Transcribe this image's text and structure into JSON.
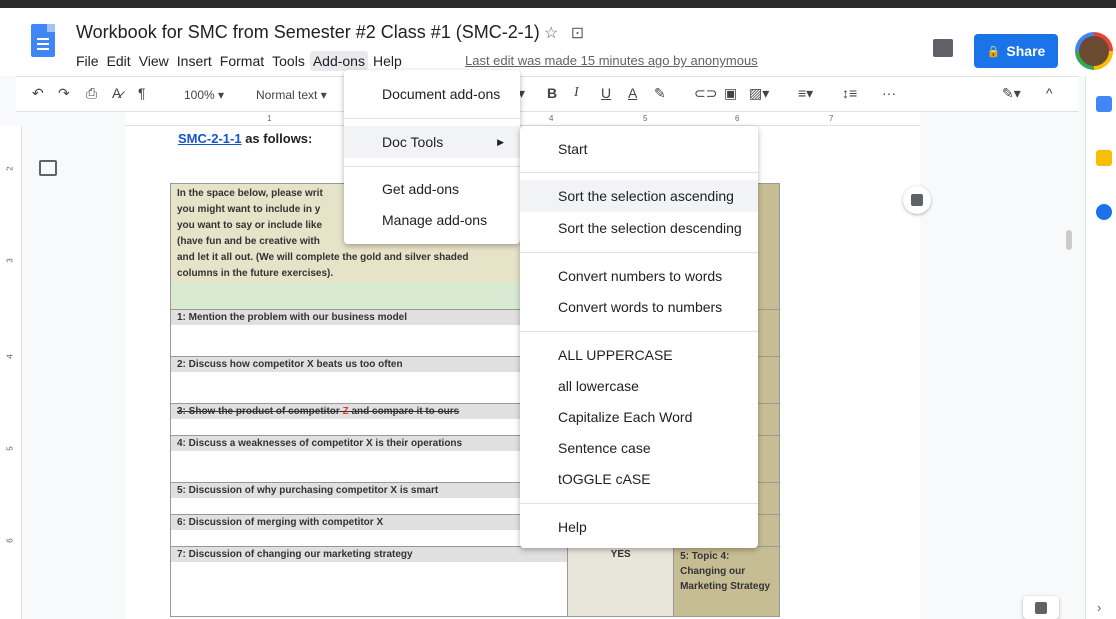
{
  "document": {
    "title": "Workbook for SMC from Semester #2 Class #1 (SMC-2-1)",
    "star_icon": "☆",
    "move_icon": "⊡",
    "last_edit": "Last edit was made 15 minutes ago by anonymous"
  },
  "menu": [
    "File",
    "Edit",
    "View",
    "Insert",
    "Format",
    "Tools",
    "Add-ons",
    "Help"
  ],
  "header": {
    "share_label": "Share",
    "share_icon": "🔒"
  },
  "toolbar": {
    "zoom": "100%",
    "style": "Normal text",
    "bold": "B",
    "italic": "I",
    "underline": "U",
    "text_color": "A",
    "more": "···"
  },
  "ruler": {
    "h": [
      "1",
      "4",
      "5",
      "6",
      "7"
    ],
    "v": [
      "2",
      "3",
      "4",
      "5",
      "6"
    ]
  },
  "page": {
    "heading_link": "SMC-2-1-1",
    "heading_rest": " as follows:",
    "prompt": "In the space below, please write ... you might want to include in y... you want to say or include like... (have fun and be creative with ... and let it all out. (We will complete the gold and silver shaded columns in the future exercises).",
    "prompt_lines": [
      "In the space below, please writ",
      "you might want to include in y",
      "you want to say or include like",
      "(have fun and be creative with",
      "and let it all out. (We will complete the gold and silver shaded",
      "columns in the future exercises)."
    ],
    "rows": [
      {
        "text": "1: Mention the problem with our business model"
      },
      {
        "text": "2: Discuss how competitor X beats us too often"
      },
      {
        "text_a": "3: Show the product of competitor ",
        "text_red": "Z",
        "text_b": " and compare it to ours"
      },
      {
        "text": "4: Discuss a weaknesses of competitor X is their operations"
      },
      {
        "text": "5: Discussion of why purchasing competitor X is smart"
      },
      {
        "text": "6: Discussion of merging with competitor X"
      },
      {
        "text": "7: Discussion of changing our marketing strategy",
        "silver": "YES",
        "gold": "5: Topic 4: Changing our Marketing Strategy"
      }
    ]
  },
  "addons_menu": {
    "items": [
      "Document add-ons",
      "Doc Tools",
      "Get add-ons",
      "Manage add-ons"
    ],
    "submenu_arrow": "▶"
  },
  "doc_tools_menu": {
    "items": [
      "Start",
      "Sort the selection ascending",
      "Sort the selection descending",
      "Convert numbers to words",
      "Convert words to numbers",
      "ALL UPPERCASE",
      "all lowercase",
      "Capitalize Each Word",
      "Sentence case",
      "tOGGLE cASE",
      "Help"
    ]
  },
  "colors": {
    "accent": "#1a73e8",
    "gold": "#c7bd95",
    "silver": "#e8e6da"
  }
}
